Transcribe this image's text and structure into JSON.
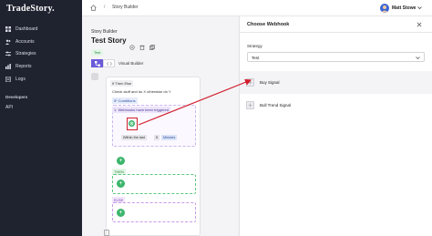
{
  "sidebar": {
    "brand": "TradeStory.",
    "items": [
      {
        "label": "Dashboard",
        "icon": "grid-icon"
      },
      {
        "label": "Accounts",
        "icon": "users-icon"
      },
      {
        "label": "Strategies",
        "icon": "sliders-icon"
      },
      {
        "label": "Reports",
        "icon": "chart-icon"
      },
      {
        "label": "Logs",
        "icon": "document-icon"
      }
    ],
    "developers_title": "Developers",
    "dev_items": [
      {
        "label": "API"
      }
    ]
  },
  "topbar": {
    "breadcrumb_sep": "/",
    "breadcrumb": "Story Builder",
    "user_name": "Matt Stowe"
  },
  "main": {
    "page_subtitle": "Story Builder",
    "page_title": "Test Story",
    "tag": "Test",
    "tab_label": "Visual Builder",
    "flow": {
      "head": "If Then Else",
      "description": "Check stuff and do X otherwise do Y",
      "if_label": "IF Conditions",
      "condition": "1. Webhooks have been triggered",
      "within": "Within the last",
      "number": "5",
      "unit": "Minutes",
      "then_label": "THEN",
      "else_label": "ELSE"
    }
  },
  "modal": {
    "title": "Choose Webhook",
    "strategy_label": "Strategy",
    "strategy_value": "Test",
    "options": [
      {
        "label": "Buy Signal"
      },
      {
        "label": "Bull Trend Signal"
      }
    ]
  },
  "colors": {
    "sidebar_bg": "#1f2330",
    "accent": "#6a5bd9",
    "green": "#3bb56b",
    "annotation_red": "#d21f2e"
  }
}
